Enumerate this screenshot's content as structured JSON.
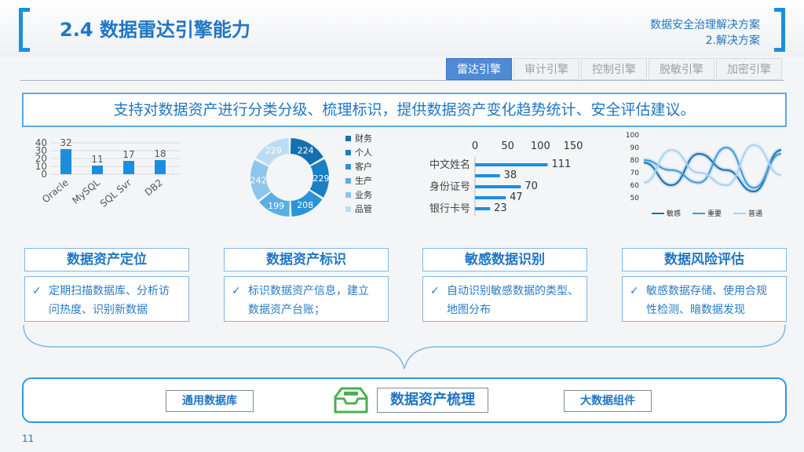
{
  "header": {
    "title": "2.4 数据雷达引擎能力",
    "subtitle_line1": "数据安全治理解决方案",
    "subtitle_line2": "2.解决方案"
  },
  "tabs": [
    "雷达引擎",
    "审计引擎",
    "控制引擎",
    "脱敏引擎",
    "加密引擎"
  ],
  "banner": "支持对数据资产进行分类分级、梳理标识，提供数据资产变化趋势统计、安全评估建议。",
  "colors": {
    "accent": "#1f76c4",
    "bar": "#1a8fe0"
  },
  "chart_data": [
    {
      "type": "bar",
      "categories": [
        "Oracle",
        "MySQL",
        "SQL Svr",
        "DB2"
      ],
      "values": [
        32,
        11,
        17,
        18
      ],
      "yticks": [
        "40",
        "30",
        "20",
        "10",
        "0"
      ],
      "ylim": [
        0,
        40
      ]
    },
    {
      "type": "pie",
      "labels": [
        "财务",
        "个人",
        "客户",
        "生产",
        "业务",
        "品管"
      ],
      "values": [
        224,
        229,
        208,
        199,
        242,
        229
      ],
      "colors": [
        "#1470b0",
        "#1a80c4",
        "#2b94d6",
        "#5aaee3",
        "#8cc6ec",
        "#bcdcf3"
      ]
    },
    {
      "type": "bar",
      "orientation": "horizontal",
      "categories": [
        "中文姓名",
        "身份证号",
        "银行卡号"
      ],
      "series": [
        {
          "values": [
            111,
            70,
            23
          ]
        },
        {
          "values": [
            38,
            47,
            0
          ]
        }
      ],
      "xticks": [
        "0",
        "50",
        "100",
        "150"
      ],
      "xlim": [
        0,
        150
      ]
    },
    {
      "type": "line",
      "yticks": [
        "100",
        "90",
        "80",
        "70",
        "60",
        "50"
      ],
      "ylim": [
        50,
        100
      ],
      "series": [
        {
          "name": "敏感",
          "values": [
            78,
            60,
            85,
            72,
            55,
            88
          ]
        },
        {
          "name": "重要",
          "values": [
            80,
            72,
            62,
            90,
            58,
            85
          ]
        },
        {
          "name": "普通",
          "values": [
            62,
            88,
            70,
            60,
            92,
            68
          ]
        }
      ]
    }
  ],
  "categories": [
    {
      "title": "数据资产定位",
      "line1": "定期扫描数据库、分析访",
      "line2": "问热度、识别新数据"
    },
    {
      "title": "数据资产标识",
      "line1": "标识数据资产信息，建立",
      "line2": "数据资产台账；"
    },
    {
      "title": "敏感数据识别",
      "line1": "自动识别敏感数据的类型、",
      "line2": "地图分布"
    },
    {
      "title": "数据风险评估",
      "line1": "敏感数据存储、使用合规",
      "line2": "性检测、暗数据发现"
    }
  ],
  "check_mark": "✓",
  "bottom": {
    "left": "通用数据库",
    "center": "数据资产梳理",
    "right": "大数据组件"
  },
  "page_number": "11"
}
